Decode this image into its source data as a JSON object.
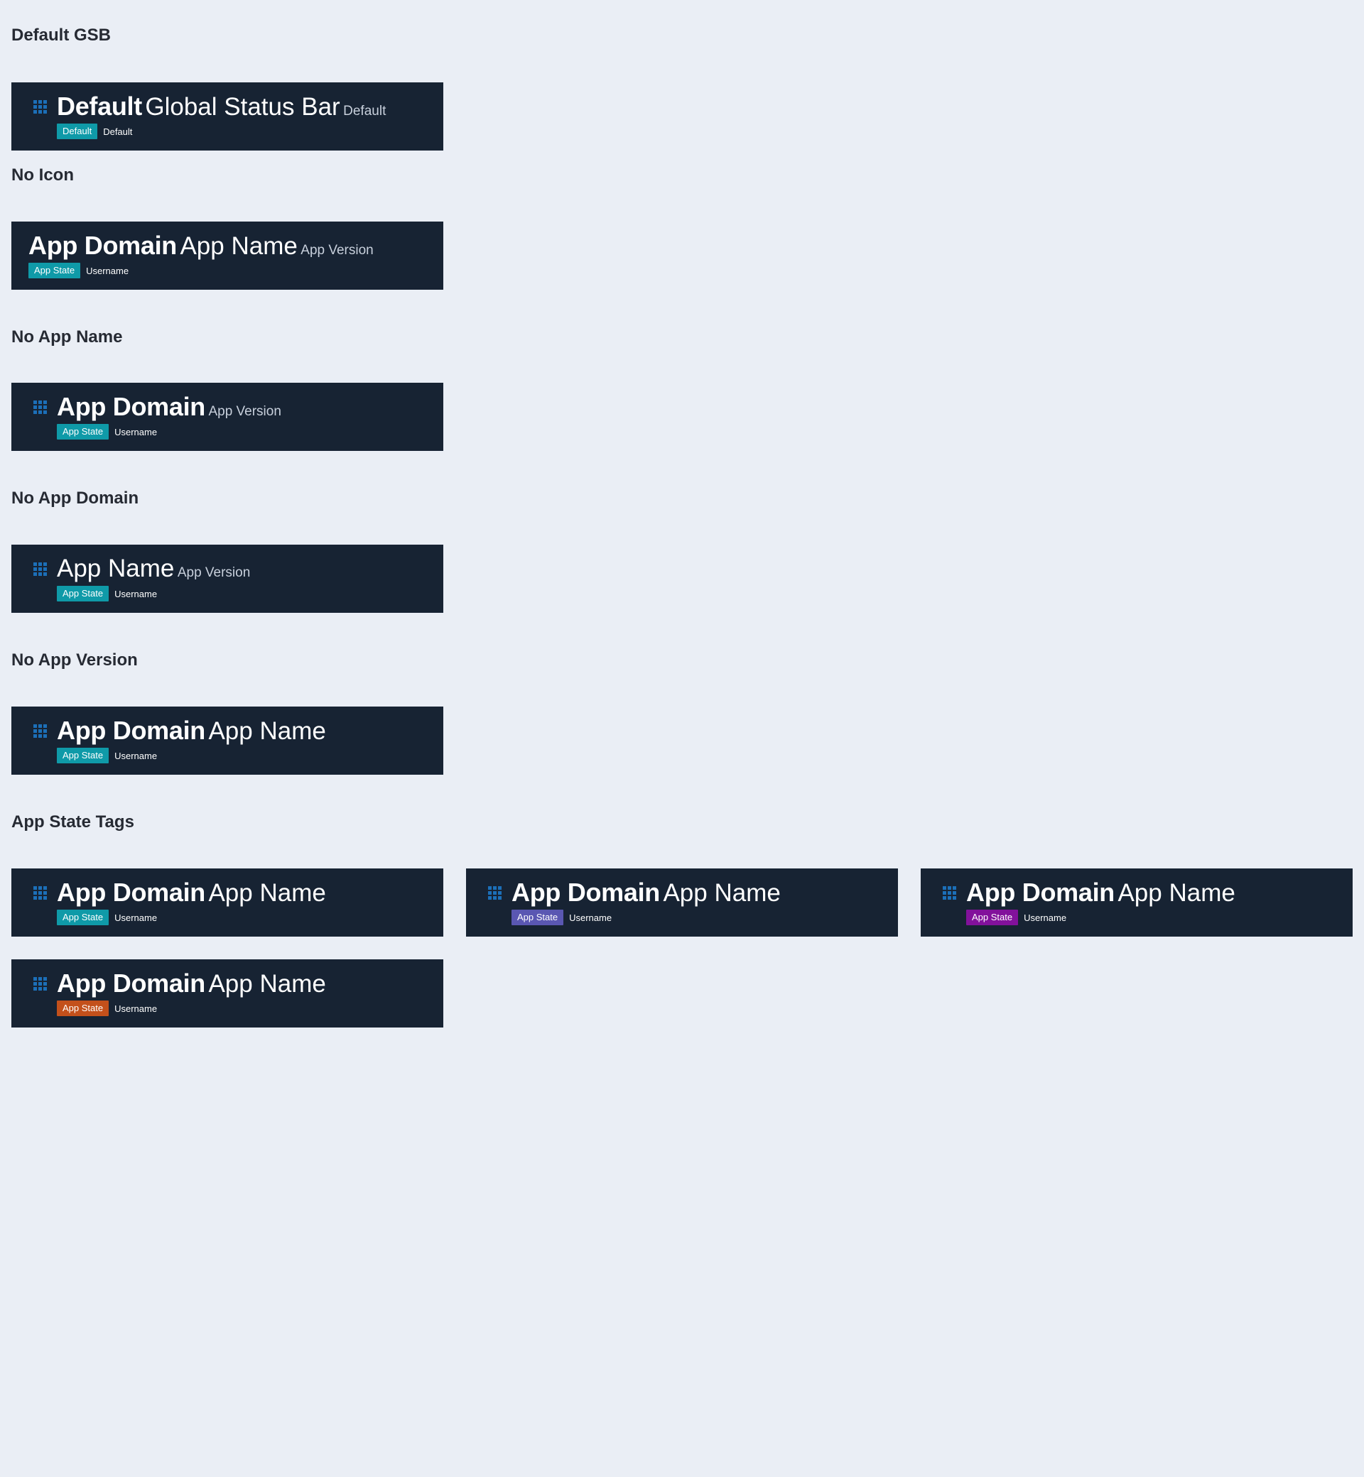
{
  "colors": {
    "background": "#eaeef5",
    "bar": "#172333",
    "icon": "#1c6fb8",
    "tag_teal": "#0f9aa8",
    "tag_indigo": "#5a57b2",
    "tag_purple": "#82119b",
    "tag_orange": "#c3501b"
  },
  "sections": {
    "default_gsb": "Default GSB",
    "no_icon": "No Icon",
    "no_app_name": "No App Name",
    "no_app_domain": "No App Domain",
    "no_app_version": "No App Version",
    "app_state_tags": "App State Tags"
  },
  "bars": {
    "default": {
      "icon": "grid-icon",
      "domain": "Default",
      "name": "Global Status Bar",
      "version": "Default",
      "state": "Default",
      "username": "Default"
    },
    "no_icon": {
      "domain": "App Domain",
      "name": "App Name",
      "version": "App Version",
      "state": "App State",
      "username": "Username"
    },
    "no_app_name": {
      "icon": "grid-icon",
      "domain": "App Domain",
      "version": "App Version",
      "state": "App State",
      "username": "Username"
    },
    "no_app_domain": {
      "icon": "grid-icon",
      "name": "App Name",
      "version": "App Version",
      "state": "App State",
      "username": "Username"
    },
    "no_app_version": {
      "icon": "grid-icon",
      "domain": "App Domain",
      "name": "App Name",
      "state": "App State",
      "username": "Username"
    },
    "tags": [
      {
        "icon": "grid-icon",
        "domain": "App Domain",
        "name": "App Name",
        "state": "App State",
        "username": "Username",
        "tag_color": "#0f9aa8"
      },
      {
        "icon": "grid-icon",
        "domain": "App Domain",
        "name": "App Name",
        "state": "App State",
        "username": "Username",
        "tag_color": "#5a57b2"
      },
      {
        "icon": "grid-icon",
        "domain": "App Domain",
        "name": "App Name",
        "state": "App State",
        "username": "Username",
        "tag_color": "#82119b"
      },
      {
        "icon": "grid-icon",
        "domain": "App Domain",
        "name": "App Name",
        "state": "App State",
        "username": "Username",
        "tag_color": "#c3501b"
      }
    ]
  }
}
